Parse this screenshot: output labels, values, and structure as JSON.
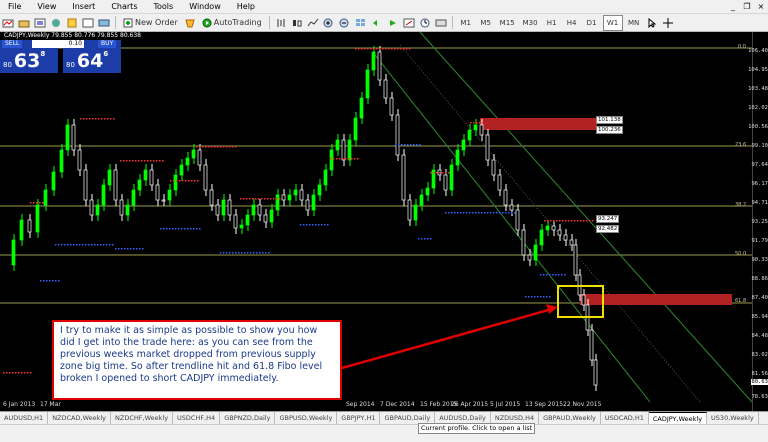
{
  "menu": [
    "File",
    "View",
    "Insert",
    "Charts",
    "Tools",
    "Window",
    "Help"
  ],
  "window_controls": [
    "_",
    "❐",
    "×"
  ],
  "toolbar": {
    "new_order": "New Order",
    "autotrading": "AutoTrading",
    "timeframes": [
      "M1",
      "M5",
      "M15",
      "M30",
      "H1",
      "H4",
      "D1",
      "W1",
      "MN"
    ],
    "active_timeframe": "W1"
  },
  "chart": {
    "title": "CADJPY,Weekly  79.855 80.776 79.855 80.638",
    "trade_panel": {
      "sell_label": "SELL",
      "buy_label": "BUY",
      "lot": "0.10",
      "sell_price_small": "80",
      "sell_price_big": "63",
      "sell_price_sup": "8",
      "buy_price_small": "80",
      "buy_price_big": "64",
      "buy_price_sup": "6"
    },
    "price_axis": [
      "106.40",
      "104.95",
      "103.48",
      "102.02",
      "100.56",
      "99.10",
      "97.64",
      "96.17",
      "94.71",
      "93.25",
      "91.79",
      "90.33",
      "88.86",
      "87.40",
      "85.94",
      "84.48",
      "83.02",
      "81.56",
      "80.63",
      "78.63"
    ],
    "fibo_levels": [
      "0.0",
      "23.6",
      "38.2",
      "50.0",
      "61.8"
    ],
    "price_tags": [
      "101.138",
      "100.236",
      "93.247",
      "92.482"
    ],
    "dates": [
      "6 Jan 2013",
      "17 Mar",
      "Sep 2014",
      "7 Dec 2014",
      "15 Feb 2015",
      "26 Apr 2015",
      "5 Jul 2015",
      "13 Sep 2015",
      "22 Nov 2015"
    ],
    "annotation": "I try to make it as simple as possible to show you how did I get into the trade here: as you can see from the previous weeks market dropped from previous supply zone big time. So after trendline hit and 61.8 Fibo level broken I opened to short CADJPY immediately.",
    "colors": {
      "up_candle": "#00ff00",
      "down_candle": "#ffffff",
      "supply_zone": "#b22222",
      "fibo_line": "#9a9a50",
      "trend_line": "#2e8b2e",
      "annotation_border": "#e00000",
      "annotation_text": "#1a3a8a"
    }
  },
  "tabs": [
    "AUDUSD,H1",
    "NZDCAD,Weekly",
    "NZDCHF,Weekly",
    "USDCHF,H4",
    "GBPNZD,Daily",
    "GBPUSD,Weekly",
    "GBPJPY,H1",
    "GBPAUD,Daily",
    "AUDUSD,Daily",
    "NZDUSD,H4",
    "GBPAUD,Weekly",
    "USDCAD,H1",
    "CADJPY,Weekly",
    "US30,Weekly"
  ],
  "active_tab": "CADJPY,Weekly",
  "status": {
    "message": "Current profile. Click to open a list"
  }
}
